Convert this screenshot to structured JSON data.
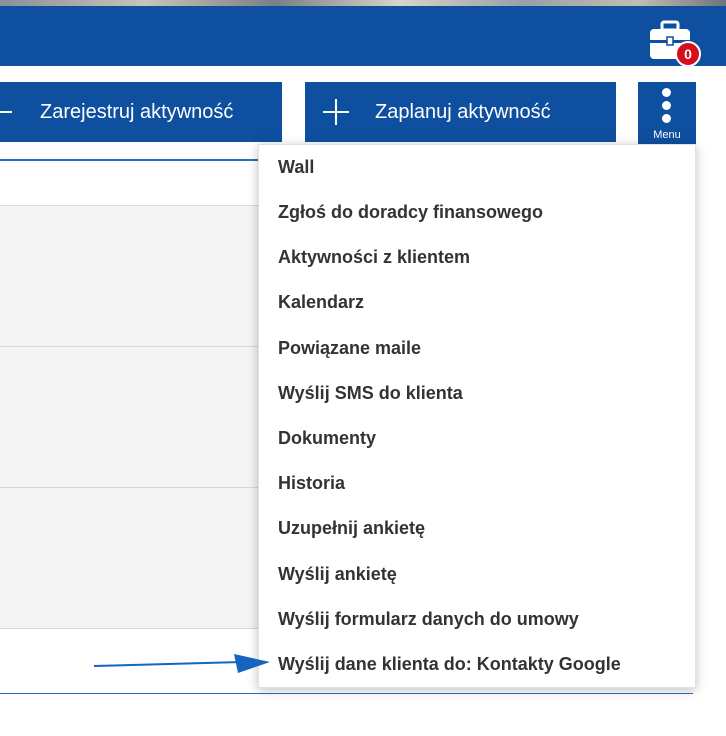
{
  "header": {
    "briefcase_icon": "briefcase-icon",
    "badge_count": "0"
  },
  "actions": {
    "register_label": "Zarejestruj aktywność",
    "plan_label": "Zaplanuj aktywność",
    "menu_label": "Menu"
  },
  "menu": {
    "items": [
      "Wall",
      "Zgłoś do doradcy finansowego",
      "Aktywności z klientem",
      "Kalendarz",
      "Powiązane maile",
      "Wyślij SMS do klienta",
      "Dokumenty",
      "Historia",
      "Uzupełnij ankietę",
      "Wyślij ankietę",
      "Wyślij formularz danych do umowy",
      "Wyślij dane klienta do: Kontakty Google"
    ]
  },
  "colors": {
    "brand_blue": "#0f4fa0",
    "badge_red": "#d50f1c",
    "arrow_blue": "#1565c0"
  }
}
